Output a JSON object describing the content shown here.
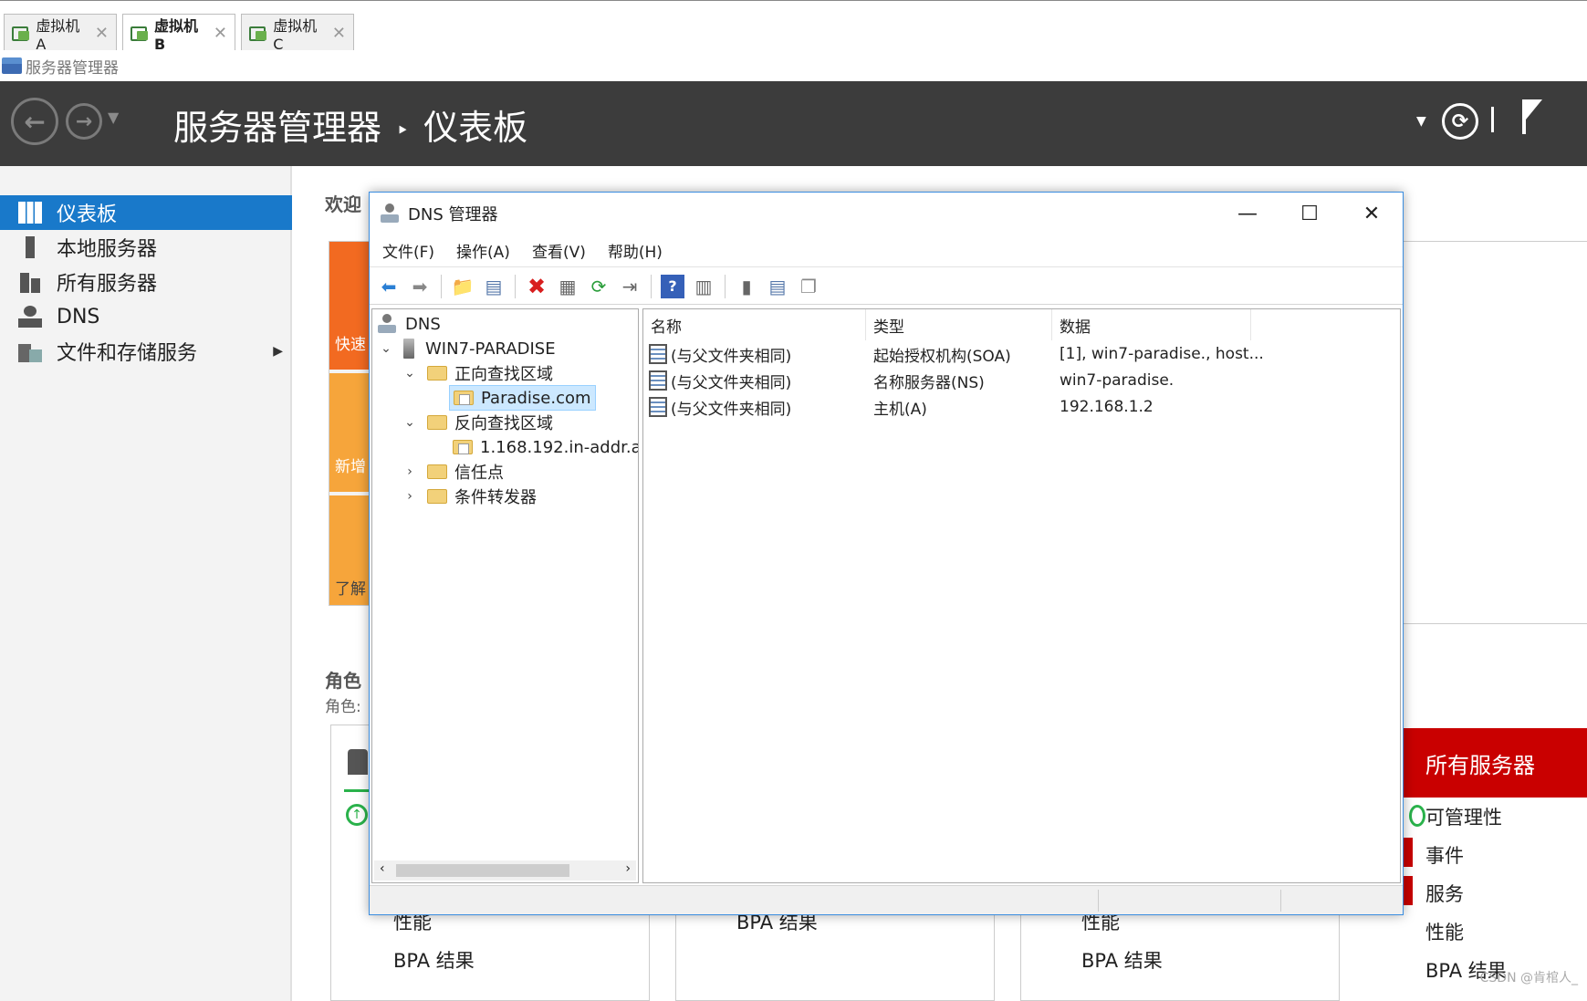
{
  "vm_tabs": [
    {
      "label": "虚拟机A",
      "active": false
    },
    {
      "label": "虚拟机B",
      "active": true
    },
    {
      "label": "虚拟机C",
      "active": false
    }
  ],
  "app_title": "服务器管理器",
  "header": {
    "breadcrumb_root": "服务器管理器",
    "breadcrumb_sep": "‣",
    "breadcrumb_current": "仪表板"
  },
  "left_nav": {
    "items": [
      {
        "label": "仪表板",
        "selected": true
      },
      {
        "label": "本地服务器"
      },
      {
        "label": "所有服务器"
      },
      {
        "label": "DNS"
      },
      {
        "label": "文件和存储服务"
      }
    ]
  },
  "dashboard": {
    "welcome": "欢迎",
    "quick_start": "快速",
    "whats_new": "新增",
    "learn_more": "了解",
    "roles_title": "角色",
    "roles_sub": "角色:",
    "bottom_labels": [
      "性能",
      "BPA 结果",
      "BPA 结果",
      "性能",
      "BPA 结果"
    ]
  },
  "dns_window": {
    "title": "DNS 管理器",
    "menu": [
      "文件(F)",
      "操作(A)",
      "查看(V)",
      "帮助(H)"
    ],
    "tree": {
      "root": "DNS",
      "server": "WIN7-PARADISE",
      "forward_zones": "正向查找区域",
      "forward_zone_item": "Paradise.com",
      "reverse_zones": "反向查找区域",
      "reverse_zone_item": "1.168.192.in-addr.a",
      "trust_points": "信任点",
      "conditional_forwarders": "条件转发器"
    },
    "columns": [
      "名称",
      "类型",
      "数据"
    ],
    "records": [
      {
        "name": "(与父文件夹相同)",
        "type": "起始授权机构(SOA)",
        "data": "[1], win7-paradise., host..."
      },
      {
        "name": "(与父文件夹相同)",
        "type": "名称服务器(NS)",
        "data": "win7-paradise."
      },
      {
        "name": "(与父文件夹相同)",
        "type": "主机(A)",
        "data": "192.168.1.2"
      }
    ]
  },
  "all_servers_panel": {
    "title": "所有服务器",
    "rows": [
      "可管理性",
      "事件",
      "服务",
      "性能",
      "BPA 结果"
    ]
  },
  "watermark": "CSDN @肯棺人_",
  "colors": {
    "accent": "#1979ca",
    "header": "#3c3c3c",
    "red": "#c90000",
    "orange": "#f26a21"
  }
}
